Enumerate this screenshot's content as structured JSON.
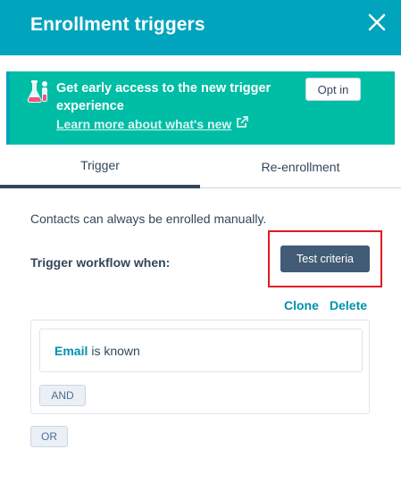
{
  "header": {
    "title": "Enrollment triggers",
    "close_icon": "close-icon"
  },
  "banner": {
    "icon": "flask-icon",
    "title": "Get early access to the new trigger experience",
    "link_text": "Learn more about what's new",
    "link_icon": "external-link-icon",
    "optin_label": "Opt in"
  },
  "tabs": [
    {
      "label": "Trigger",
      "active": true
    },
    {
      "label": "Re-enrollment",
      "active": false
    }
  ],
  "main": {
    "info_text": "Contacts can always be enrolled manually.",
    "trigger_label": "Trigger workflow when:",
    "test_criteria_label": "Test criteria",
    "clone_label": "Clone",
    "delete_label": "Delete"
  },
  "filter_group": {
    "filters": [
      {
        "property": "Email",
        "condition": "is known"
      }
    ],
    "and_label": "AND"
  },
  "or_label": "OR",
  "colors": {
    "header": "#00a4bd",
    "banner": "#00bda5",
    "primary_button": "#425b76",
    "link": "#0091ae",
    "highlight": "#e21b23"
  }
}
